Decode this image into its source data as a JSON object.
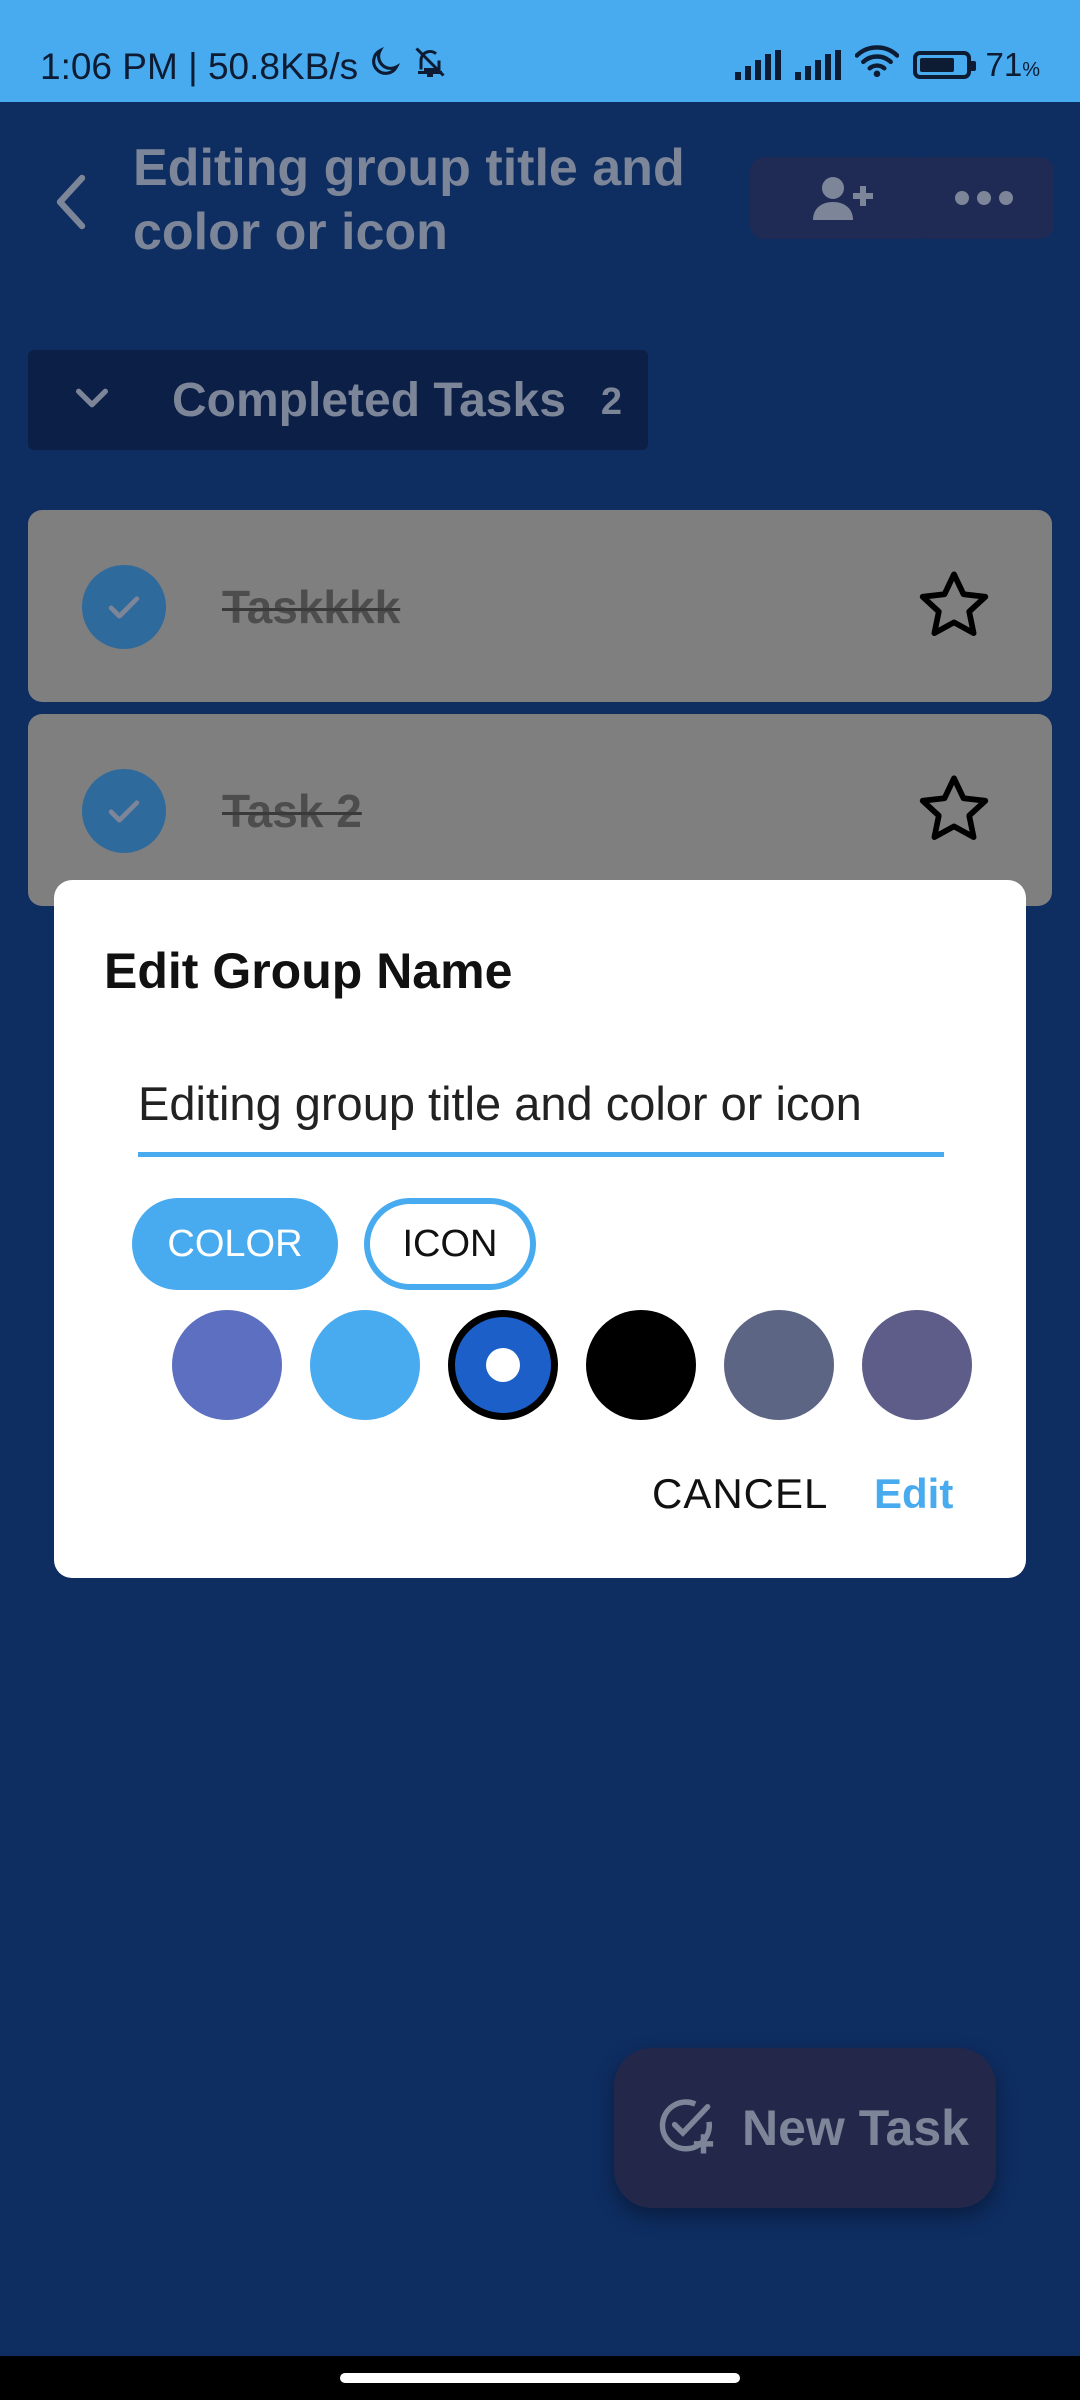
{
  "status_bar": {
    "time_speed": "1:06 PM | 50.8KB/s",
    "battery": "71",
    "battery_unit": "%",
    "icons": [
      "moon-icon",
      "bell-off-icon",
      "signal-icon",
      "signal-icon",
      "wifi-icon",
      "battery-icon"
    ]
  },
  "header": {
    "title": "Editing group title and color or icon",
    "back_icon": "chevron-left-icon",
    "add_member_icon": "person-add-icon",
    "more_icon": "more-horizontal-icon"
  },
  "section": {
    "label": "Completed Tasks",
    "count": "2",
    "icon": "chevron-down-icon"
  },
  "tasks": [
    {
      "title": "Taskkkk",
      "completed": true,
      "starred": false
    },
    {
      "title": "Task 2",
      "completed": true,
      "starred": false
    }
  ],
  "fab": {
    "label": "New Task",
    "icon": "check-add-icon"
  },
  "dialog": {
    "title": "Edit Group Name",
    "input_value": "Editing group title and color or icon",
    "tabs": [
      {
        "label": "COLOR",
        "selected": true
      },
      {
        "label": "ICON",
        "selected": false
      }
    ],
    "swatches": [
      {
        "color": "#5c6fc1",
        "selected": false
      },
      {
        "color": "#48abef",
        "selected": false
      },
      {
        "color": "#1c5fc8",
        "selected": true
      },
      {
        "color": "#000000",
        "selected": false
      },
      {
        "color": "#5d6584",
        "selected": false
      },
      {
        "color": "#5e5c88",
        "selected": false
      },
      {
        "color": "#7b8de0",
        "selected": false
      }
    ],
    "cancel_label": "CANCEL",
    "confirm_label": "Edit"
  },
  "colors": {
    "accent": "#48abef",
    "background": "#0e2d61",
    "dialog": "#ffffff"
  }
}
